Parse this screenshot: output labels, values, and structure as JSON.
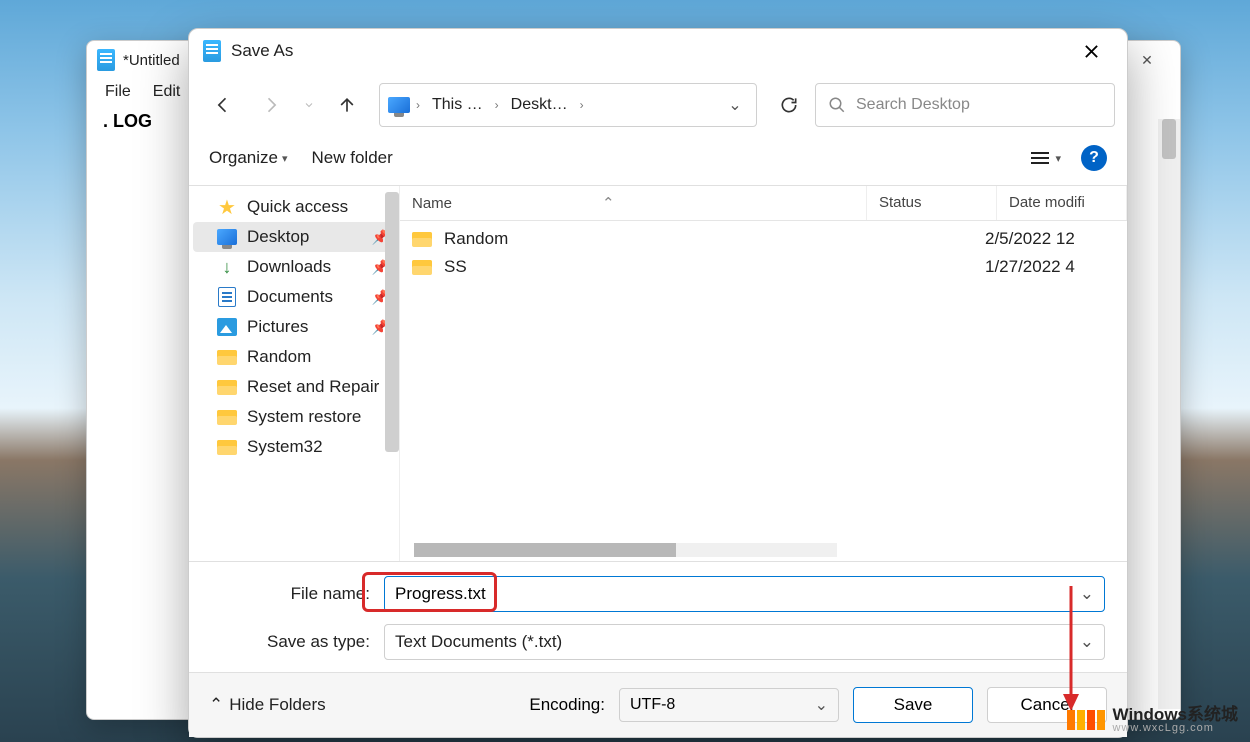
{
  "notepad": {
    "title": "*Untitled",
    "menu": {
      "file": "File",
      "edit": "Edit"
    },
    "body": ". LOG"
  },
  "dialog": {
    "title": "Save As",
    "nav": {
      "crumb1": "This …",
      "crumb2": "Deskt…",
      "search_placeholder": "Search Desktop"
    },
    "toolbar": {
      "organize": "Organize",
      "new_folder": "New folder"
    },
    "sidebar": {
      "items": [
        {
          "label": "Quick access",
          "icon": "star",
          "pinned": false
        },
        {
          "label": "Desktop",
          "icon": "monitor",
          "pinned": true,
          "selected": true
        },
        {
          "label": "Downloads",
          "icon": "download",
          "pinned": true
        },
        {
          "label": "Documents",
          "icon": "document",
          "pinned": true
        },
        {
          "label": "Pictures",
          "icon": "pictures",
          "pinned": true
        },
        {
          "label": "Random",
          "icon": "folder",
          "pinned": false
        },
        {
          "label": "Reset and Repair",
          "icon": "folder",
          "pinned": false
        },
        {
          "label": "System restore",
          "icon": "folder",
          "pinned": false
        },
        {
          "label": "System32",
          "icon": "folder",
          "pinned": false
        }
      ]
    },
    "columns": {
      "name": "Name",
      "status": "Status",
      "date": "Date modifi"
    },
    "files": [
      {
        "name": "Random",
        "date": "2/5/2022 12"
      },
      {
        "name": "SS",
        "date": "1/27/2022 4"
      }
    ],
    "filename_label": "File name:",
    "filename_value": "Progress.txt",
    "savetype_label": "Save as type:",
    "savetype_value": "Text Documents (*.txt)",
    "hide_folders": "Hide Folders",
    "encoding_label": "Encoding:",
    "encoding_value": "UTF-8",
    "save_btn": "Save",
    "cancel_btn": "Cancel"
  },
  "watermark": {
    "big": "Windows系统城",
    "small": "www.wxcLgg.com"
  }
}
